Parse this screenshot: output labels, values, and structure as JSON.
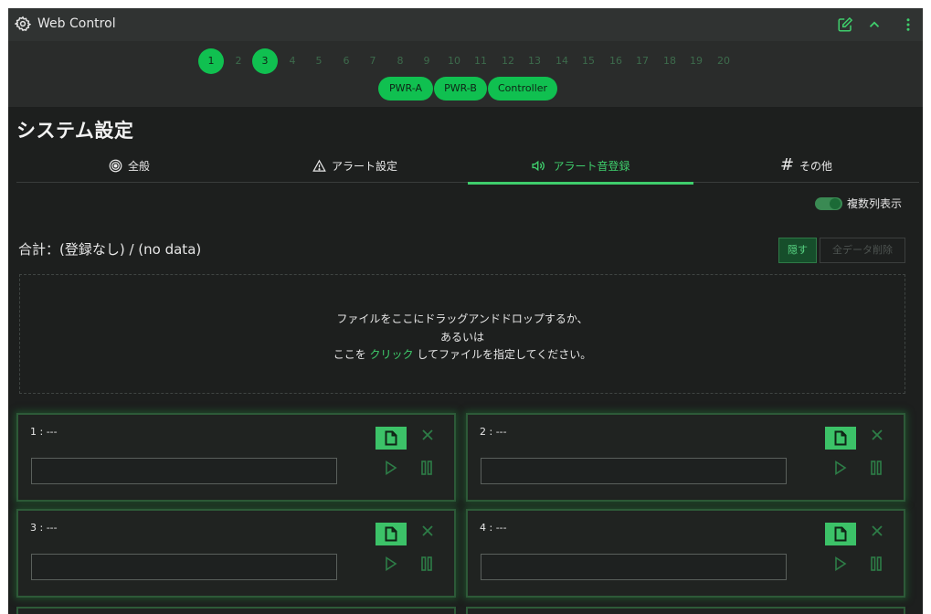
{
  "window": {
    "title": "Web Control",
    "icons": [
      "gear-icon",
      "edit-icon",
      "chevron-up-icon",
      "kebab-menu-icon"
    ]
  },
  "channels": {
    "numbers": [
      "1",
      "2",
      "3",
      "4",
      "5",
      "6",
      "7",
      "8",
      "9",
      "10",
      "11",
      "12",
      "13",
      "14",
      "15",
      "16",
      "17",
      "18",
      "19",
      "20"
    ],
    "active": [
      "1",
      "3"
    ],
    "groups": [
      "PWR-A",
      "PWR-B",
      "Controller"
    ]
  },
  "page": {
    "title": "システム設定"
  },
  "tabs": [
    {
      "label": "全般",
      "icon": "target-icon"
    },
    {
      "label": "アラート設定",
      "icon": "warning-icon"
    },
    {
      "label": "アラート音登録",
      "icon": "speaker-icon",
      "active": true
    },
    {
      "label": "その他",
      "icon": "hash-icon"
    }
  ],
  "multi_column": {
    "label": "複数列表示",
    "enabled": true
  },
  "summary": {
    "total_text": "合計：(登録なし) / (no data)",
    "hide_label": "隠す",
    "delete_all_label": "全データ削除"
  },
  "dropzone": {
    "line1": "ファイルをここにドラッグアンドドロップするか、",
    "line2": "あるいは",
    "line3_prefix": "ここを ",
    "line3_link": "クリック",
    "line3_suffix": " してファイルを指定してください。"
  },
  "slots": [
    {
      "label": "1 : ---",
      "value": ""
    },
    {
      "label": "2 : ---",
      "value": ""
    },
    {
      "label": "3 : ---",
      "value": ""
    },
    {
      "label": "4 : ---",
      "value": ""
    }
  ],
  "colors": {
    "accent": "#3fce6c",
    "channel_active": "#10c050",
    "background": "#1d1f1e"
  }
}
